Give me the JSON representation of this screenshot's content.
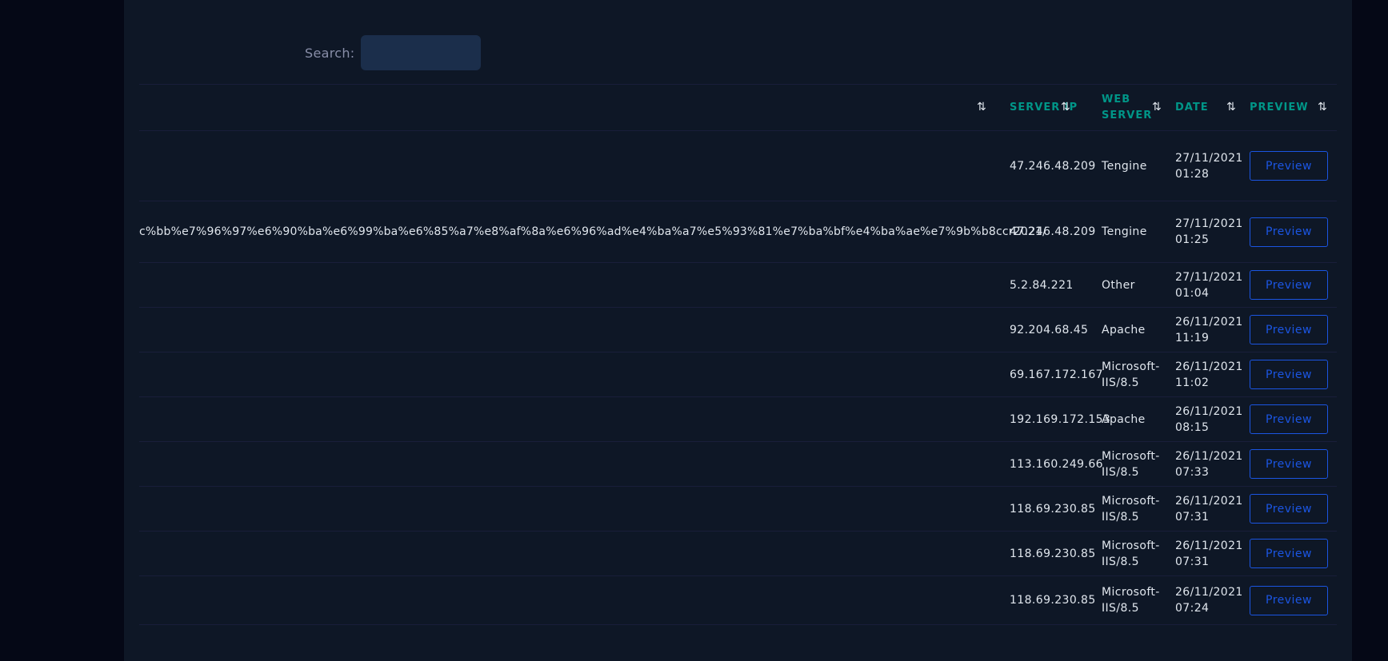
{
  "search": {
    "label": "Search:",
    "value": ""
  },
  "table": {
    "columns": [
      {
        "label": ""
      },
      {
        "label": "SERVER IP"
      },
      {
        "label": "WEB SERVER"
      },
      {
        "label": "DATE"
      },
      {
        "label": "PREVIEW"
      }
    ],
    "sort_icon": "⇅",
    "rows": [
      {
        "url": "",
        "ip": "47.246.48.209",
        "server": "Tengine",
        "date": "27/11/2021",
        "time": "01:28",
        "preview": "Preview"
      },
      {
        "url": "c%bb%e7%96%97%e6%90%ba%e6%99%ba%e6%85%a7%e8%af%8a%e6%96%ad%e4%ba%a7%e5%93%81%e7%ba%bf%e4%ba%ae%e7%9b%b8ccr2021/",
        "ip": "47.246.48.209",
        "server": "Tengine",
        "date": "27/11/2021",
        "time": "01:25",
        "preview": "Preview"
      },
      {
        "url": "",
        "ip": "5.2.84.221",
        "server": "Other",
        "date": "27/11/2021",
        "time": "01:04",
        "preview": "Preview"
      },
      {
        "url": "",
        "ip": "92.204.68.45",
        "server": "Apache",
        "date": "26/11/2021",
        "time": "11:19",
        "preview": "Preview"
      },
      {
        "url": "",
        "ip": "69.167.172.167",
        "server": "Microsoft-IIS/8.5",
        "date": "26/11/2021",
        "time": "11:02",
        "preview": "Preview"
      },
      {
        "url": "",
        "ip": "192.169.172.153",
        "server": "Apache",
        "date": "26/11/2021",
        "time": "08:15",
        "preview": "Preview"
      },
      {
        "url": "",
        "ip": "113.160.249.66",
        "server": "Microsoft-IIS/8.5",
        "date": "26/11/2021",
        "time": "07:33",
        "preview": "Preview"
      },
      {
        "url": "",
        "ip": "118.69.230.85",
        "server": "Microsoft-IIS/8.5",
        "date": "26/11/2021",
        "time": "07:31",
        "preview": "Preview"
      },
      {
        "url": "",
        "ip": "118.69.230.85",
        "server": "Microsoft-IIS/8.5",
        "date": "26/11/2021",
        "time": "07:31",
        "preview": "Preview"
      },
      {
        "url": "",
        "ip": "118.69.230.85",
        "server": "Microsoft-IIS/8.5",
        "date": "26/11/2021",
        "time": "07:24",
        "preview": "Preview"
      }
    ]
  },
  "colors": {
    "background": "#050816",
    "panel": "#0e1726",
    "header_text": "#009688",
    "button_border": "#1b55e2"
  }
}
